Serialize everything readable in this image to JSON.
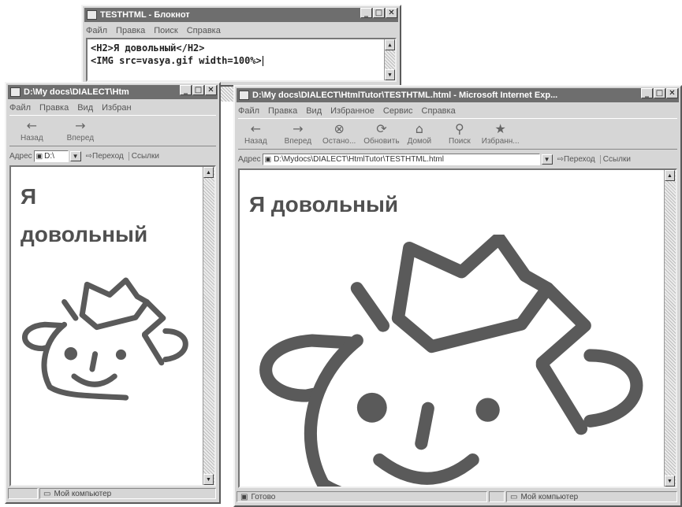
{
  "notepad": {
    "title": "TESTHTML - Блокнот",
    "menu": [
      "Файл",
      "Правка",
      "Поиск",
      "Справка"
    ],
    "lines": [
      "<H2>Я довольный</H2>",
      "<IMG src=vasya.gif width=100%>"
    ]
  },
  "browser_small": {
    "title": "D:\\My docs\\DIALECT\\Htm",
    "menu": [
      "Файл",
      "Правка",
      "Вид",
      "Избран"
    ],
    "toolbar": [
      {
        "label": "Назад",
        "icon": "back-arrow-icon"
      },
      {
        "label": "Вперед",
        "icon": "forward-arrow-icon"
      }
    ],
    "address_label": "Адрес",
    "address_value": "D:\\",
    "go_label": "Переход",
    "links_label": "Ссылки",
    "heading_line1": "Я",
    "heading_line2": "довольный",
    "status_text": "Мой компьютер"
  },
  "browser_large": {
    "title": "D:\\My docs\\DIALECT\\HtmlTutor\\TESTHTML.html - Microsoft Internet Exp...",
    "menu": [
      "Файл",
      "Правка",
      "Вид",
      "Избранное",
      "Сервис",
      "Справка"
    ],
    "toolbar": [
      {
        "label": "Назад",
        "icon": "back-arrow-icon"
      },
      {
        "label": "Вперед",
        "icon": "forward-arrow-icon"
      },
      {
        "label": "Остано...",
        "icon": "stop-icon"
      },
      {
        "label": "Обновить",
        "icon": "refresh-icon"
      },
      {
        "label": "Домой",
        "icon": "home-icon"
      },
      {
        "label": "Поиск",
        "icon": "search-icon"
      },
      {
        "label": "Избранн...",
        "icon": "favorites-icon"
      }
    ],
    "address_label": "Адрес",
    "address_value": "D:\\Mydocs\\DIALECT\\HtmlTutor\\TESTHTML.html",
    "go_label": "Переход",
    "links_label": "Ссылки",
    "heading": "Я довольный",
    "status_left": "Готово",
    "status_right": "Мой компьютер"
  },
  "colors": {
    "drawing": "#5a5a5a",
    "title_bar": "#6e6e6e",
    "chrome": "#d6d6d6"
  }
}
